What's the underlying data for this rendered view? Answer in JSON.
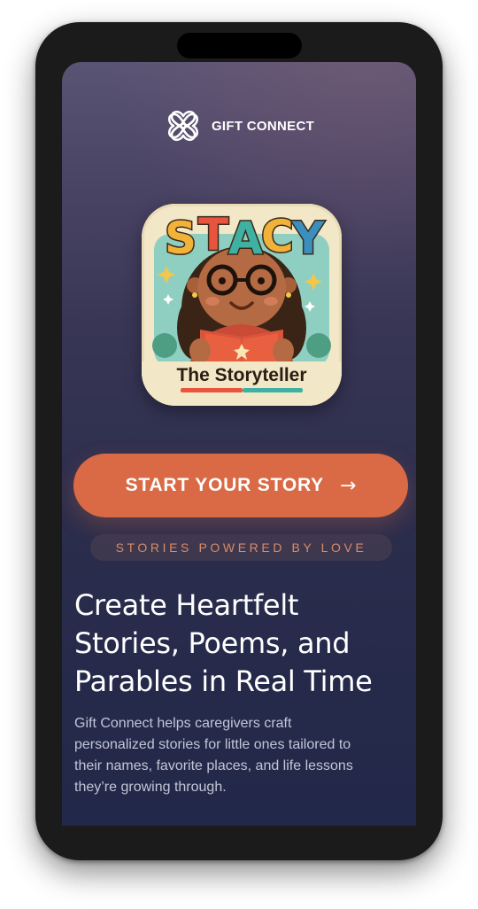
{
  "brand": {
    "name": "GIFT CONNECT",
    "logo_icon": "heart-knot-logo-icon"
  },
  "app_icon": {
    "title": "STACY",
    "subtitle": "The Storyteller",
    "title_colors": [
      "#f2b23a",
      "#e8553e",
      "#3fb1a3",
      "#f2b23a",
      "#3b8fbf"
    ]
  },
  "cta": {
    "label": "START YOUR STORY",
    "arrow": "→",
    "color": "#d96a45"
  },
  "tagline": "STORIES POWERED BY LOVE",
  "headline": "Create Heartfelt Stories, Poems, and Parables in Real Time",
  "description": "Gift Connect helps caregivers craft personalized stories for little ones tailored to their names, favorite places, and life lessons they’re growing through."
}
